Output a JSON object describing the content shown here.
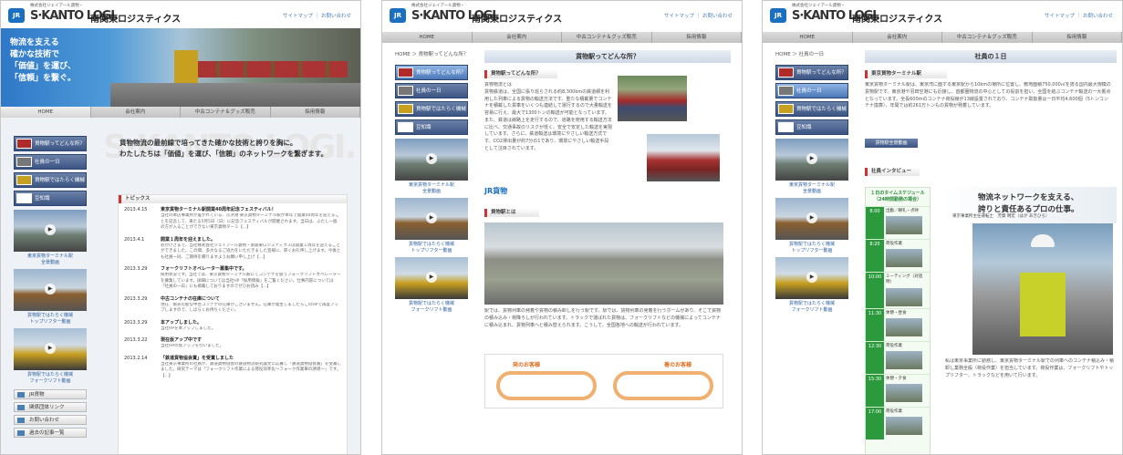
{
  "brand": {
    "jr": "JR",
    "corp": "株式会社ジェイアール貨物・",
    "en": "S·KANTO LOGI.",
    "jp": "南関東ロジスティクス",
    "toplinks": "サイトマップ ｜ お問い合わせ"
  },
  "nav": [
    "HOME",
    "会社案内",
    "中古コンテナ＆グッズ販売",
    "採用情報"
  ],
  "sidebar": [
    "貨物駅ってどんな所？",
    "社員の一日",
    "貨物駅ではたらく機械",
    "豆知識"
  ],
  "thumbs": [
    "東京貨物ターミナル駅\n全景動画",
    "貨物駅ではたらく機械\nトップリフター動画",
    "貨物駅ではたらく機械\nフォークリフト動画"
  ],
  "page1": {
    "hero": [
      "物流を支える",
      "確かな技術で",
      "「価値」を運び、",
      "「信頼」を繋ぐ。"
    ],
    "tagline1": "貨物物流の最前線で培ってきた確かな技術と誇りを胸に。",
    "tagline2": "わたしたちは「価値」を運び、「信頼」のネットワークを繋ぎます。",
    "topics_title": "トピックス",
    "topics": [
      {
        "date": "2013.4.15",
        "title": "東京貨物ターミナル駅開業40周年記念フェスティバル！",
        "body": "当社の本店事業所が置かれている、京浜港 東京貨物ターミナル駅が本年で開業40周年を迎えることを記念して、来たる5月5日（日）に記念フェスティバルが開催されます。当日は、ぶたし一般の方が入ることができない東京貨物ターミ【...】"
      },
      {
        "date": "2013.4.1",
        "title": "開業１周年を迎えました。",
        "body": "おかげさまで、当社株式会社ジェイアール貨物・南関東ロジスティクスは開業１周年を迎えることができました。この間、多大なるご協力をいただきました皆様に、厚くお礼申し上げます。今後とも社員一同、ご期待を賜りますようお願い申し上げ【...】"
      },
      {
        "date": "2013.3.29",
        "title": "フォークリフトオペレーター募集中です。",
        "body": "採用状況です。当社では、東京貨物ターミナル駅にてコンテナを扱うフォークリフトオペレーターを募集しています。詳細については当社HP「採用情報」をご覧ください。仕事内容については「社員の一日」にも掲載しておりますのでぜひお読み【...】"
      },
      {
        "date": "2013.3.29",
        "title": "中古コンテナの在庫について",
        "body": "現在、販売可能な中古コンテナの在庫がございません。在庫が発生しましたらこのHPで再度アップしますので、しばらくお待ちください。"
      },
      {
        "date": "2013.3.29",
        "title": "本アップしました。",
        "body": "当社HPを本アップしました。"
      },
      {
        "date": "2013.3.22",
        "title": "現在仮アップ中です",
        "body": "当社HPの仮アップを行いました。"
      },
      {
        "date": "2013.2.14",
        "title": "「鉄道貨物協会賞」を受賞しました",
        "body": "当社東京事業所の社員が、鉄道貨物協会の鉄道物流研究論文に応募し「鉄道貨物協会賞」を受賞しました。研究テーマは「フォークリフト作業による荷役効率化～フォーク作業車の誘導～」です。【...】"
      }
    ],
    "footer_links": [
      "JR貨物",
      "関係団体リンク",
      "お問い合わせ",
      "過去の記事一覧"
    ]
  },
  "page2": {
    "breadcrumb": "HOME ＞ 貨物駅ってどんな所？",
    "title": "貨物駅ってどんな所？",
    "sec1": "貨物駅ってどんな所？",
    "sec1_body": "貨物物流とは\n貨物鉄道は、全国に張り巡らされる約8,300kmの鉄道網を利用した列車による貨物の輸送方法です。重たな積載量でコンテナを積載した貨車をいくつも連結して運行するので大量輸送を容易に行え、最大で1300トンの輸送が可能となっています。また、鉄道は線路上を走行するので、道路を使用する輸送方法に比べ、交通事故のリスクが低く、安全で安定した輸送を実現しています。さらに、鉄道輸送は環境にやさしい輸送方式です。CO2排出量が約7分の1であり、環境にやさしい輸送手段として注目されています。",
    "jrlogo": "JR貨物",
    "sec2": "貨物駅とは",
    "sec2_body": "駅では、貨物列車の発着や貨物の積み卸しを行う駅です。駅では、貨物列車の発着を行うホームがあり、そこで貨物の積み込み・荷降ろしが行われています。トラックで運ばれた貨物は、フォークリフトなどの機械によってコンテナに積み込まれ、貨物列車へと積み替えられます。こうして、全国各地への輸送が行われています。",
    "flow_from": "発のお客様",
    "flow_to": "着のお客様"
  },
  "page3": {
    "breadcrumb": "HOME ＞ 社員の一日",
    "title": "社員の１日",
    "sec1": "東京貨物ターミナル駅",
    "sec1_body": "東京貨物ターミナル駅は、東京湾に面する東京駅から10kmの場所に位置し、敷地面積750,000㎡を誇る国内最大規模の貨物駅です。東京港や羽田空港にも近接し、首都圏物流の中心としての役割を担い、全国を結ぶコンテナ輸送の一大拠点となっています。全長600mのコンテナ荷役線が13線設置されており、コンテナ取扱量は一日平均4,600個（5トンコンテナ換算）、年間では約261万トンもの貨物が発着しています。",
    "sec1_btn": "貨物駅全景動画",
    "interview": "社員インタビュー",
    "schedule_title": "１日のタイムスケジュール\n（24時間勤務の場合）",
    "schedule": [
      {
        "time": "8:00",
        "task": "出勤／朝礼・点呼"
      },
      {
        "time": "8:20",
        "task": "荷役作業"
      },
      {
        "time": "10:00",
        "task": "ミーティング（対話時）"
      },
      {
        "time": "11:30",
        "task": "休憩・昼食"
      },
      {
        "time": "12:30",
        "task": "荷役作業"
      },
      {
        "time": "15:30",
        "task": "休憩・夕食"
      },
      {
        "time": "17:00",
        "task": "荷役作業"
      }
    ],
    "banner1": "物流ネットワークを支える、",
    "banner2": "誇りと責任あるプロの仕事。",
    "person": "東京事業所主任運転士　芳賀 明宏（はが あきひろ）",
    "bottom": "私は東京事業所に勤務し、東京貨物ターミナル駅での列車へのコンテナ積込み・積卸し業務全般（荷役作業）を担当しています。荷役作業は、フォークリフトやトップリフター、トラックなどを用いて行います。"
  }
}
